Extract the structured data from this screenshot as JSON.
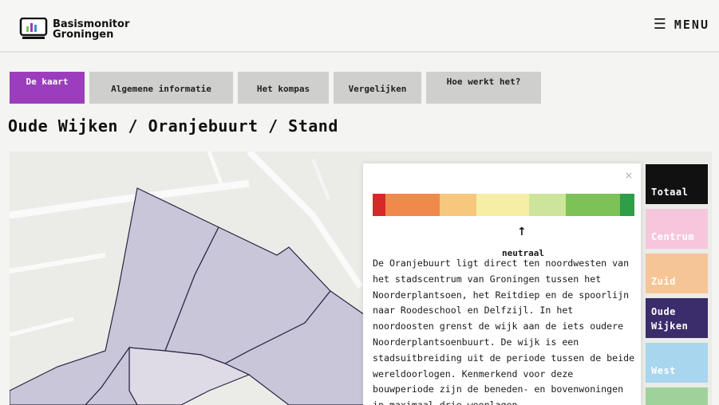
{
  "header": {
    "logo_line1": "Basismonitor",
    "logo_line2": "Groningen",
    "menu_icon": "hamburger-icon",
    "menu_label": "MENU"
  },
  "tabs": [
    {
      "label": "De kaart",
      "active": true
    },
    {
      "label": "Algemene informatie",
      "active": false
    },
    {
      "label": "Het kompas",
      "active": false
    },
    {
      "label": "Vergelijken",
      "active": false
    },
    {
      "label": "Hoe werkt het?",
      "active": false
    }
  ],
  "page_title": "Oude Wijken / Oranjebuurt / Stand",
  "popup": {
    "close_symbol": "×",
    "scale_colors": [
      "#d62a2a",
      "#f08a4b",
      "#f7c77e",
      "#f6eea4",
      "#cde59a",
      "#7cc256",
      "#2e9e48"
    ],
    "arrow": "↑",
    "marker_label": "neutraal",
    "description": "De Oranjebuurt ligt direct ten noordwesten van het stadscentrum van Groningen tussen het Noorderplantsoen, het Reitdiep en de spoorlijn naar Roodeschool en Delfzijl. In het noordoosten grenst de wijk aan de iets oudere Noorderplantsoenbuurt. De wijk is een stadsuitbreiding uit de periode tussen de beide wereldoorlogen. Kenmerkend voor deze bouwperiode zijn de beneden- en bovenwoningen in maximaal drie woonlagen."
  },
  "regions": [
    {
      "label": "Totaal",
      "color": "#111111",
      "text_color": "#ffffff"
    },
    {
      "label": "Centrum",
      "color": "#f6c7dc",
      "text_color": "#ffffff"
    },
    {
      "label": "Zuid",
      "color": "#f6c596",
      "text_color": "#ffffff"
    },
    {
      "label": "Oude Wijken",
      "color": "#3b2c6b",
      "text_color": "#ffffff"
    },
    {
      "label": "West",
      "color": "#a8d6ee",
      "text_color": "#ffffff"
    },
    {
      "label": "",
      "color": "#9fd29a",
      "text_color": "#ffffff"
    }
  ],
  "colors": {
    "accent": "#9b3dbd",
    "map_fill": "#c9c6da",
    "map_stroke": "#2b2440"
  }
}
